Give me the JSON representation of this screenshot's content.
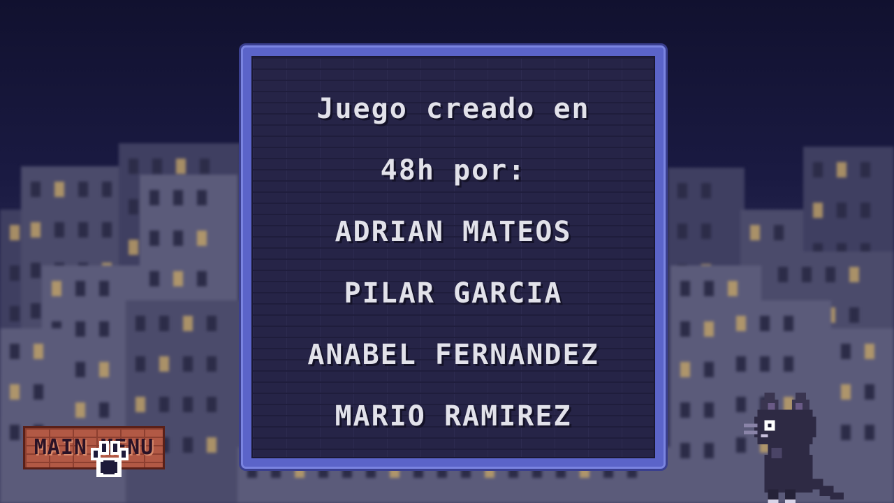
{
  "credits": {
    "lines": [
      "Juego creado en",
      "48h por:",
      "ADRIAN MATEOS",
      "PILAR GARCIA",
      "ANABEL FERNANDEZ",
      "MARIO RAMIREZ"
    ]
  },
  "main_menu": {
    "label": "MAIN MENU",
    "icon": "paw-icon"
  },
  "cat": {
    "icon": "cat-icon"
  },
  "colors": {
    "panel_border": "#5b64c9",
    "panel_fill": "#262447",
    "text": "#e2e2ea",
    "button_brick": "#b25945",
    "sky": "#11112f"
  }
}
